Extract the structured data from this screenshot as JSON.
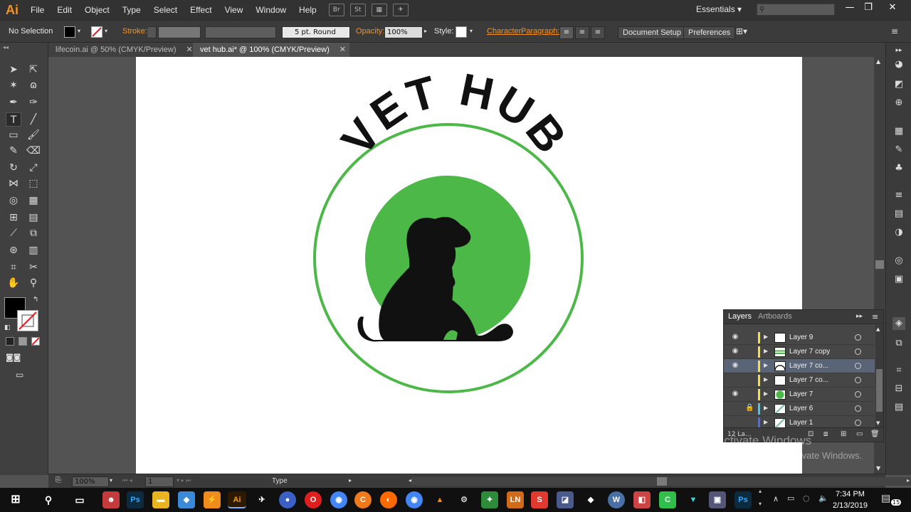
{
  "app": {
    "logo": "Ai",
    "workspace": "Essentials"
  },
  "menu": [
    "File",
    "Edit",
    "Object",
    "Type",
    "Select",
    "Effect",
    "View",
    "Window",
    "Help"
  ],
  "control_bar": {
    "selection": "No Selection",
    "stroke_label": "Stroke:",
    "brush": "5 pt. Round",
    "opacity_label": "Opacity:",
    "opacity_value": "100%",
    "style_label": "Style:",
    "character_link": "Character",
    "paragraph_link": "Paragraph:",
    "document_setup": "Document Setup",
    "preferences": "Preferences"
  },
  "tabs": [
    {
      "label": "lifecoin.ai @ 50% (CMYK/Preview)",
      "active": false
    },
    {
      "label": "vet hub.ai* @ 100% (CMYK/Preview)",
      "active": true
    }
  ],
  "artwork": {
    "title": "VET HUB",
    "ring_color": "#4cb848",
    "fill_color": "#4cb848",
    "silhouette_color": "#111111"
  },
  "layers_panel": {
    "tabs": [
      "Layers",
      "Artboards"
    ],
    "rows": [
      {
        "name": "Layer 9",
        "visible": true,
        "locked": false,
        "color": "#f5e142",
        "thumb": "white"
      },
      {
        "name": "Layer 7 copy",
        "visible": true,
        "locked": false,
        "color": "#f5e142",
        "thumb": "green-lines"
      },
      {
        "name": "Layer 7 co...",
        "visible": true,
        "locked": false,
        "color": "#f5e142",
        "thumb": "arc",
        "selected": true
      },
      {
        "name": "Layer 7 co...",
        "visible": false,
        "locked": false,
        "color": "#f5e142",
        "thumb": "white"
      },
      {
        "name": "Layer 7",
        "visible": true,
        "locked": false,
        "color": "#f5e142",
        "thumb": "green-circle"
      },
      {
        "name": "Layer 6",
        "visible": false,
        "locked": true,
        "color": "#45c7e6",
        "thumb": "small-art"
      },
      {
        "name": "Layer 1",
        "visible": false,
        "locked": false,
        "color": "#4a6cf0",
        "thumb": "small-art"
      }
    ],
    "footer_count": "12 La..."
  },
  "status_bar": {
    "zoom": "100%",
    "artboard": "1",
    "tool": "Type"
  },
  "watermark": {
    "line1": "Activate Windows",
    "line2": "Go to Settings to activate Windows."
  },
  "clock": {
    "time": "7:34 PM",
    "date": "2/13/2019"
  },
  "notifications": "15"
}
